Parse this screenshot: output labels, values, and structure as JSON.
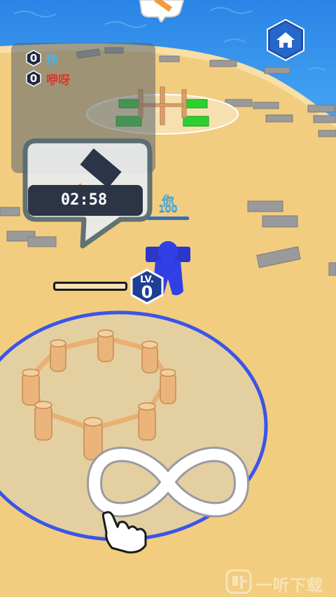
{
  "scoreboard": {
    "players": [
      {
        "score": "0",
        "name": "你",
        "color": "#4fb3e8"
      },
      {
        "score": "0",
        "name": "咿呀",
        "color": "#e8322c"
      }
    ]
  },
  "timer": {
    "value": "02:58"
  },
  "player": {
    "name": "你",
    "hp": "100",
    "color": "#2f3fe0"
  },
  "level": {
    "label": "LV.",
    "value": "0",
    "progress": 0
  },
  "home_button": {
    "icon": "home-icon"
  },
  "gesture_hint": {
    "icon": "infinity-swipe-icon"
  },
  "watermark": {
    "text": "一听下载"
  },
  "colors": {
    "sand": "#f2cd7f",
    "water": "#2f8de8",
    "zone": "#3a55e6",
    "fence": "#e9b074"
  }
}
